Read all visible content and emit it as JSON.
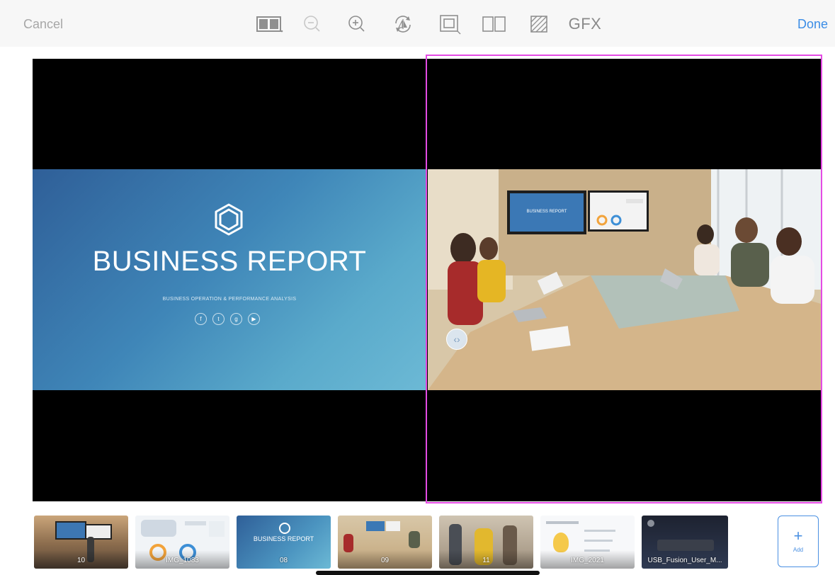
{
  "toolbar": {
    "cancel_label": "Cancel",
    "done_label": "Done",
    "gfx_label": "GFX",
    "tools": [
      "layout-icon",
      "zoom-out-icon",
      "zoom-in-icon",
      "rotate-flip-icon",
      "crop-frame-icon",
      "split-view-icon",
      "pattern-icon"
    ]
  },
  "slide": {
    "title": "BUSINESS REPORT",
    "subtitle": "BUSINESS OPERATION & PERFORMANCE ANALYSIS",
    "socials": [
      "f",
      "t",
      "g",
      "▶"
    ]
  },
  "photo_slide": {
    "monitor_title": "BUSINESS REPORT"
  },
  "thumbnails": [
    {
      "label": "10"
    },
    {
      "label": "IMG_1083"
    },
    {
      "label": "08",
      "thumb_title": "BUSINESS REPORT"
    },
    {
      "label": "09"
    },
    {
      "label": "11"
    },
    {
      "label": "IMG_2021"
    },
    {
      "label": "USB_Fusion_User_M..."
    }
  ],
  "add_button": {
    "label": "Add"
  },
  "colors": {
    "accent": "#3b8de6",
    "selection": "#e44be4",
    "canvas": "#000000"
  }
}
